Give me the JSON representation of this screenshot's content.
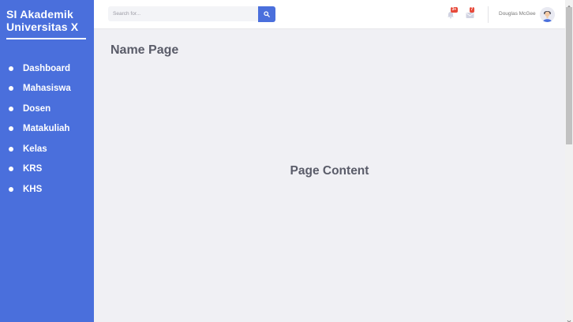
{
  "sidebar": {
    "brand_line1": "SI Akademik",
    "brand_line2": "Universitas X",
    "items": [
      {
        "label": "Dashboard"
      },
      {
        "label": "Mahasiswa"
      },
      {
        "label": "Dosen"
      },
      {
        "label": "Matakuliah"
      },
      {
        "label": "Kelas"
      },
      {
        "label": "KRS"
      },
      {
        "label": "KHS"
      }
    ]
  },
  "topbar": {
    "search_placeholder": "Search for...",
    "alerts_count": "3+",
    "messages_count": "7",
    "user_name": "Douglas McGee"
  },
  "main": {
    "page_title": "Name Page",
    "page_content": "Page Content"
  },
  "colors": {
    "primary": "#4a6fdc",
    "badge": "#e74a3b",
    "text_dark": "#5a5c69",
    "background": "#f0f0f4"
  },
  "icons": {
    "search": "search-icon",
    "alerts": "bell-icon",
    "messages": "envelope-icon",
    "avatar": "user-avatar"
  }
}
